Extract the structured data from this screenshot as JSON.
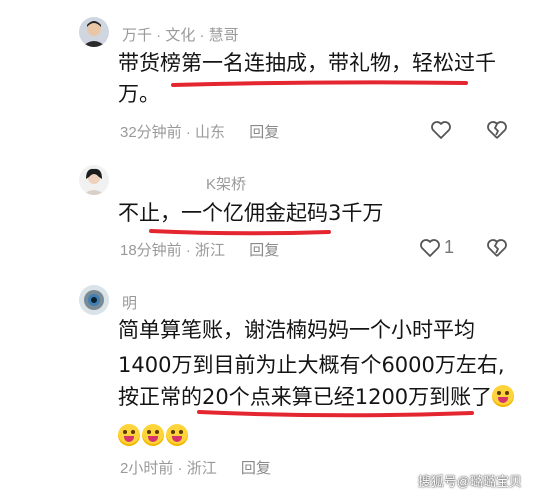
{
  "comments": [
    {
      "username": "万千 · 文化 · 慧哥",
      "text": "带货榜第一名连抽成，带礼物，轻松过千万。",
      "time": "32分钟前",
      "location": "山东",
      "reply_label": "回复",
      "like_count": ""
    },
    {
      "username": "K架桥",
      "text": "不止，一个亿佣金起码3千万",
      "time": "18分钟前",
      "location": "浙江",
      "reply_label": "回复",
      "like_count": "1"
    },
    {
      "username": "明",
      "text_line1": "简单算笔账，谢浩楠妈妈一个小时平均",
      "text_line2": "1400万到目前为止大概有个6000万左右,",
      "text_line3": "按正常的20个点来算已经1200万到账了",
      "time": "2小时前",
      "location": "浙江",
      "reply_label": "回复"
    }
  ],
  "separator": "·",
  "watermark": "搜狐号@璐璐宝贝",
  "colors": {
    "underline": "#e3262f",
    "meta": "#9a9a9a"
  },
  "icons": [
    "heart-outline-icon",
    "broken-heart-icon",
    "laughing-crying-emoji"
  ]
}
